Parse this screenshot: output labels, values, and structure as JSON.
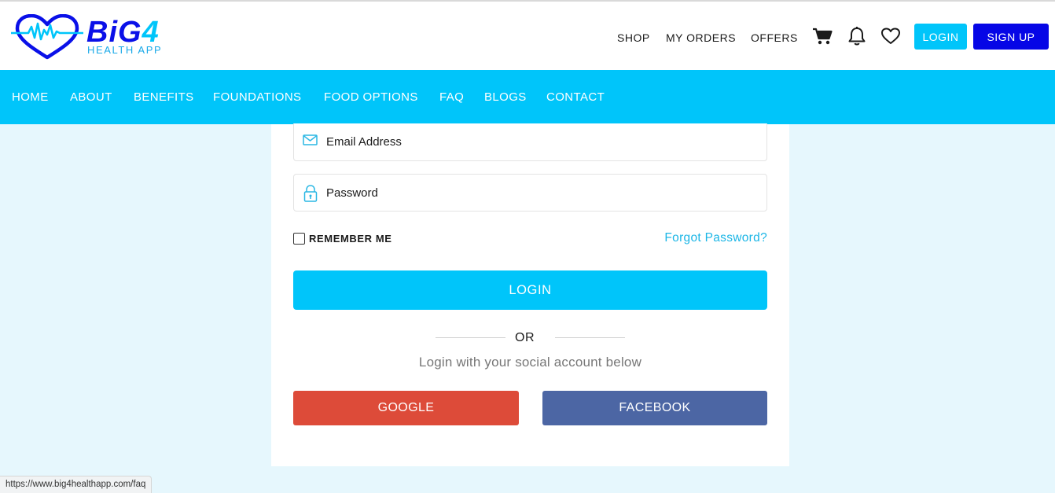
{
  "logo": {
    "brand_main": "BiG",
    "brand_digit": "4",
    "brand_sub": "HEALTH APP"
  },
  "topbar": {
    "links": [
      "SHOP",
      "MY ORDERS",
      "OFFERS"
    ],
    "icons": [
      "cart-icon",
      "bell-icon",
      "heart-icon"
    ],
    "login_label": "LOGIN",
    "signup_label": "SIGN UP"
  },
  "nav": {
    "items": [
      "HOME",
      "ABOUT",
      "BENEFITS",
      "FOUNDATIONS",
      "FOOD OPTIONS",
      "FAQ",
      "BLOGS",
      "CONTACT"
    ]
  },
  "form": {
    "email_placeholder": "Email Address",
    "password_placeholder": "Password",
    "remember_label": "REMEMBER ME",
    "remember_checked": false,
    "forgot_label": "Forgot Password?",
    "login_label": "LOGIN",
    "or_label": "OR",
    "social_text": "Login with your social account below",
    "google_label": "GOOGLE",
    "facebook_label": "FACEBOOK"
  },
  "status_bar": {
    "url": "https://www.big4healthapp.com/faq"
  },
  "colors": {
    "accent": "#00c5fa",
    "brand_blue": "#0606e6",
    "google": "#dd4b39",
    "facebook": "#4c66a4",
    "page_bg": "#e6f7fd"
  }
}
